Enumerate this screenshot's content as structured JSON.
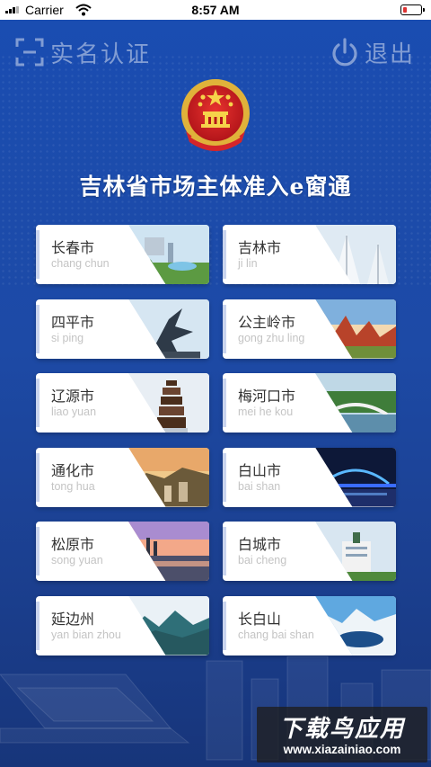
{
  "status_bar": {
    "carrier": "Carrier",
    "time": "8:57 AM"
  },
  "nav": {
    "left_label": "实名认证",
    "left_icon": "scan-id-icon",
    "right_label": "退出",
    "right_icon": "power-icon"
  },
  "title": "吉林省市场主体准入e窗通",
  "colors": {
    "background": "#1d4aa6",
    "card": "#ffffff",
    "title": "#ffffff",
    "pinyin": "#c4c4c4"
  },
  "cities": [
    {
      "name": "长春市",
      "pinyin": "chang chun"
    },
    {
      "name": "吉林市",
      "pinyin": "ji lin"
    },
    {
      "name": "四平市",
      "pinyin": "si ping"
    },
    {
      "name": "公主岭市",
      "pinyin": "gong zhu ling"
    },
    {
      "name": "辽源市",
      "pinyin": "liao yuan"
    },
    {
      "name": "梅河口市",
      "pinyin": "mei he kou"
    },
    {
      "name": "通化市",
      "pinyin": "tong hua"
    },
    {
      "name": "白山市",
      "pinyin": "bai shan"
    },
    {
      "name": "松原市",
      "pinyin": "song yuan"
    },
    {
      "name": "白城市",
      "pinyin": "bai cheng"
    },
    {
      "name": "延边州",
      "pinyin": "yan bian zhou"
    },
    {
      "name": "长白山",
      "pinyin": "chang bai shan"
    }
  ],
  "watermark": {
    "title": "下载鸟应用",
    "url": "www.xiazainiao.com"
  }
}
